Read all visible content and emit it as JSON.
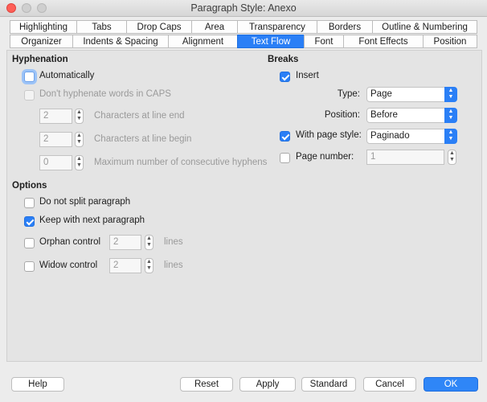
{
  "window": {
    "title": "Paragraph Style: Anexo"
  },
  "tabs_row1": [
    "Highlighting",
    "Tabs",
    "Drop Caps",
    "Area",
    "Transparency",
    "Borders",
    "Outline & Numbering"
  ],
  "tabs_row2": [
    "Organizer",
    "Indents & Spacing",
    "Alignment",
    "Text Flow",
    "Font",
    "Font Effects",
    "Position"
  ],
  "active_tab": "Text Flow",
  "hyphenation": {
    "header": "Hyphenation",
    "automatically": {
      "label": "Automatically",
      "checked": false
    },
    "dont_hyphenate_caps": {
      "label": "Don't hyphenate words in CAPS",
      "checked": false
    },
    "chars_line_end": {
      "value": "2",
      "label": "Characters at line end"
    },
    "chars_line_begin": {
      "value": "2",
      "label": "Characters at line begin"
    },
    "max_consecutive": {
      "value": "0",
      "label": "Maximum number of consecutive hyphens"
    }
  },
  "breaks": {
    "header": "Breaks",
    "insert": {
      "label": "Insert",
      "checked": true
    },
    "type": {
      "label": "Type:",
      "value": "Page"
    },
    "position": {
      "label": "Position:",
      "value": "Before"
    },
    "with_page_style": {
      "label": "With page style:",
      "checked": true,
      "value": "Paginado"
    },
    "page_number": {
      "label": "Page number:",
      "checked": false,
      "value": "1"
    }
  },
  "options": {
    "header": "Options",
    "do_not_split": {
      "label": "Do not split paragraph",
      "checked": false
    },
    "keep_with_next": {
      "label": "Keep with next paragraph",
      "checked": true
    },
    "orphan": {
      "label": "Orphan control",
      "checked": false,
      "value": "2",
      "unit": "lines"
    },
    "widow": {
      "label": "Widow control",
      "checked": false,
      "value": "2",
      "unit": "lines"
    }
  },
  "buttons": {
    "help": "Help",
    "reset": "Reset",
    "apply": "Apply",
    "standard": "Standard",
    "cancel": "Cancel",
    "ok": "OK"
  },
  "colors": {
    "accent": "#2a7ff6",
    "close": "#fe5f57"
  }
}
